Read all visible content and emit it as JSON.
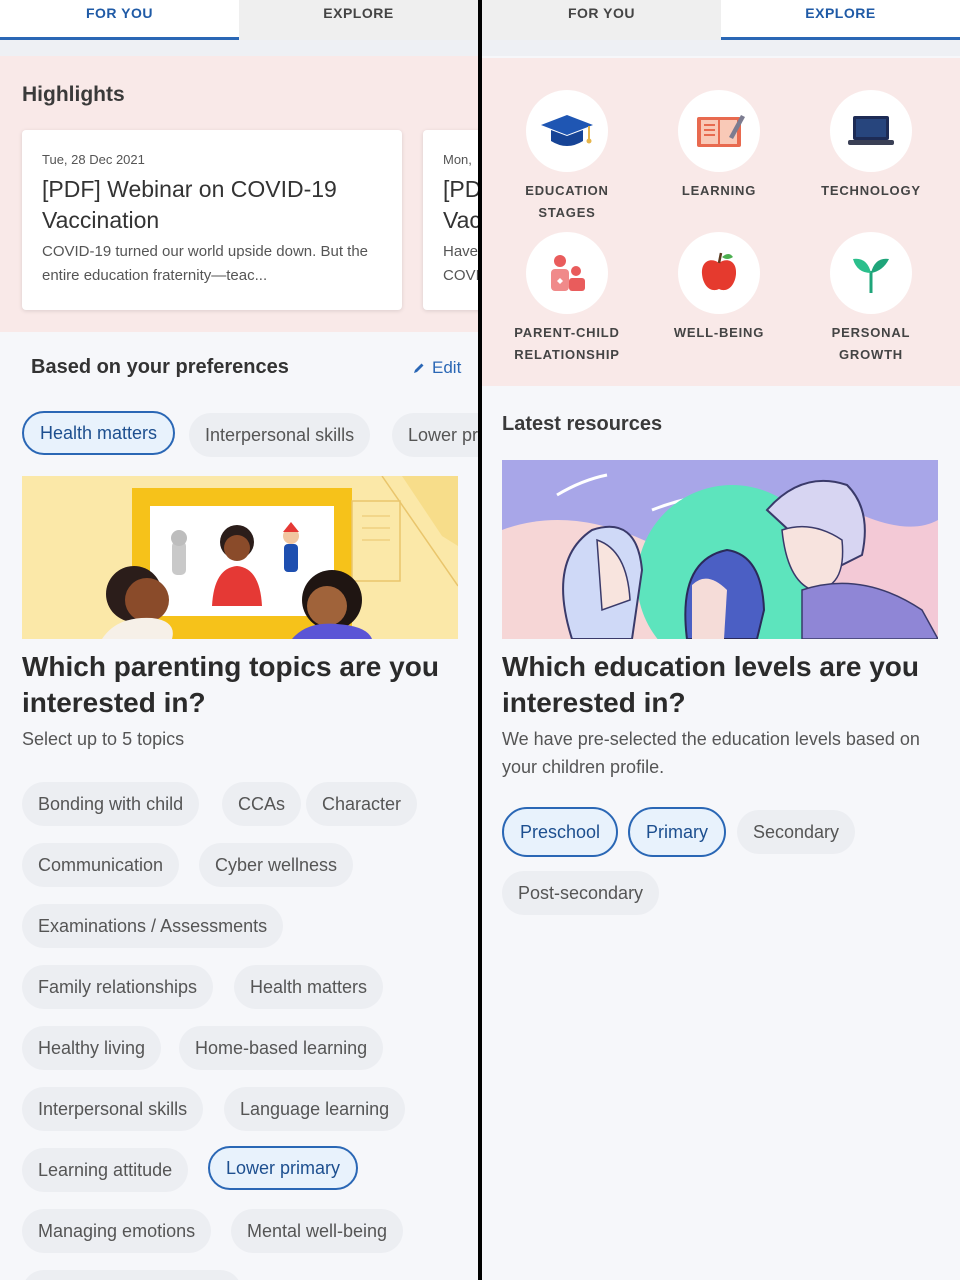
{
  "left": {
    "tabs": [
      "FOR YOU",
      "EXPLORE"
    ],
    "highlights_title": "Highlights",
    "cards": [
      {
        "date": "Tue, 28 Dec 2021",
        "title": "[PDF] Webinar on COVID-19 Vaccination",
        "desc": "COVID-19 turned our world upside down. But the entire  education fraternity—teac..."
      },
      {
        "date": "Mon,",
        "title": "[PD Vac",
        "desc": "Have COVI"
      }
    ],
    "preferences_title": "Based on your preferences",
    "edit_label": "Edit",
    "pref_chips": [
      "Health matters",
      "Interpersonal skills",
      "Lower pr"
    ],
    "question": "Which parenting topics are you interested in?",
    "subtitle": "Select up to 5 topics",
    "topics": [
      "Bonding with child",
      "CCAs",
      "Character",
      "Communication",
      "Cyber wellness",
      "Examinations / Assessments",
      "Family relationships",
      "Health matters",
      "Healthy living",
      "Home-based learning",
      "Interpersonal skills",
      "Language learning",
      "Learning attitude",
      "Lower primary",
      "Managing emotions",
      "Mental well-being"
    ]
  },
  "right": {
    "tabs": [
      "FOR YOU",
      "EXPLORE"
    ],
    "categories": [
      {
        "l1": "EDUCATION",
        "l2": "STAGES",
        "icon": "graduation-cap-icon"
      },
      {
        "l1": "LEARNING",
        "l2": "",
        "icon": "book-icon"
      },
      {
        "l1": "TECHNOLOGY",
        "l2": "",
        "icon": "laptop-icon"
      },
      {
        "l1": "PARENT-CHILD",
        "l2": "RELATIONSHIP",
        "icon": "parent-child-icon"
      },
      {
        "l1": "WELL-BEING",
        "l2": "",
        "icon": "apple-icon"
      },
      {
        "l1": "PERSONAL",
        "l2": "GROWTH",
        "icon": "sprout-icon"
      }
    ],
    "latest_title": "Latest resources",
    "question": "Which education levels are you interested in?",
    "subtitle": "We have pre-selected the education levels based on your children profile.",
    "levels": [
      "Preschool",
      "Primary",
      "Secondary",
      "Post-secondary"
    ]
  },
  "colors": {
    "accent": "#2a67b5",
    "pink_band": "#f9e9e8",
    "chip_bg": "#eceef2",
    "chip_selected_bg": "#e8f2fc"
  }
}
